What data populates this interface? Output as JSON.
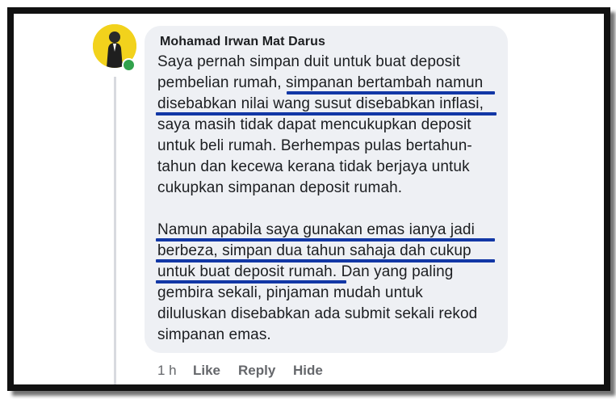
{
  "comment": {
    "author": "Mohamad Irwan Mat Darus",
    "author_online": true,
    "paragraph1": [
      "Saya pernah simpan duit untuk buat deposit",
      "pembelian rumah, simpanan bertambah namun",
      "disebabkan nilai wang susut disebabkan inflasi,",
      "saya masih tidak dapat mencukupkan deposit",
      "untuk beli rumah. Berhempas pulas bertahun-",
      "tahun dan kecewa kerana tidak berjaya untuk",
      "cukupkan simpanan deposit rumah."
    ],
    "paragraph2": [
      "Namun apabila saya gunakan emas ianya jadi",
      "berbeza, simpan dua tahun sahaja dah cukup",
      "untuk buat deposit rumah. Dan yang paling",
      "gembira sekali, pinjaman mudah untuk",
      "diluluskan disebabkan ada submit sekali rekod",
      "simpanan emas."
    ],
    "highlighted_phrases": [
      "simpanan bertambah namun disebabkan nilai wang susut disebabkan inflasi",
      "Namun apabila saya gunakan emas ianya jadi berbeza, simpan dua tahun sahaja dah cukup untuk buat deposit rumah"
    ]
  },
  "actions": {
    "timestamp": "1 h",
    "like": "Like",
    "reply": "Reply",
    "hide": "Hide"
  },
  "colors": {
    "underline": "#1237a6",
    "bubble": "#eef0f4",
    "online": "#31a24c",
    "avatar_bg": "#f2d21c"
  }
}
